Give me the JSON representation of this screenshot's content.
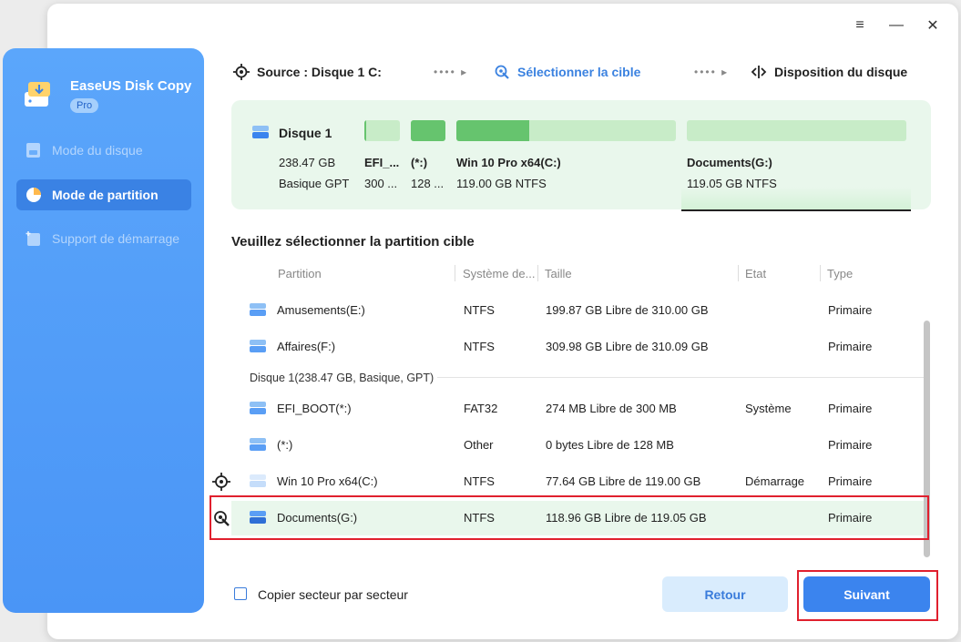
{
  "brand": {
    "name": "EaseUS Disk Copy",
    "badge": "Pro"
  },
  "nav": [
    {
      "label": "Mode du disque",
      "state": "disabled"
    },
    {
      "label": "Mode de partition",
      "state": "active"
    },
    {
      "label": "Support de démarrage",
      "state": "disabled"
    }
  ],
  "window_controls": {
    "menu": "≡",
    "minimize": "—",
    "close": "✕"
  },
  "steps": {
    "source": "Source : Disque 1 C:",
    "target": "Sélectionner la cible",
    "layout": "Disposition du disque",
    "separator": "•••• ▸"
  },
  "disk": {
    "title": "Disque 1",
    "size": "238.47 GB",
    "type": "Basique GPT",
    "partitions": [
      {
        "name": "EFI_...",
        "size": "300 ...",
        "fill": 0.05
      },
      {
        "name": "(*:)",
        "size": "128 ...",
        "fill": 1.0
      },
      {
        "name": "Win 10 Pro x64(C:)",
        "size": "119.00 GB NTFS",
        "fill": 0.33
      },
      {
        "name": "Documents(G:)",
        "size": "119.05 GB NTFS",
        "fill": 0.0
      }
    ]
  },
  "section_title": "Veuillez sélectionner la partition cible",
  "table": {
    "headers": [
      "Partition",
      "Système de...",
      "Taille",
      "Etat",
      "Type"
    ],
    "rows_top": [
      {
        "name": "Amusements(E:)",
        "fs": "NTFS",
        "size": "199.87 GB Libre de 310.00 GB",
        "state": "",
        "type": "Primaire"
      },
      {
        "name": "Affaires(F:)",
        "fs": "NTFS",
        "size": "309.98 GB Libre de 310.09 GB",
        "state": "",
        "type": "Primaire"
      }
    ],
    "group_label": "Disque 1(238.47 GB, Basique, GPT)",
    "rows_disk": [
      {
        "name": "EFI_BOOT(*:)",
        "fs": "FAT32",
        "size": "274 MB Libre de 300 MB",
        "state": "Système",
        "type": "Primaire"
      },
      {
        "name": "(*:)",
        "fs": "Other",
        "size": "0 bytes Libre de 128 MB",
        "state": "",
        "type": "Primaire"
      },
      {
        "name": "Win 10 Pro x64(C:)",
        "fs": "NTFS",
        "size": "77.64 GB Libre de 119.00 GB",
        "state": "Démarrage",
        "type": "Primaire"
      },
      {
        "name": "Documents(G:)",
        "fs": "NTFS",
        "size": "118.96 GB Libre de 119.05 GB",
        "state": "",
        "type": "Primaire"
      }
    ]
  },
  "footer": {
    "checkbox_label": "Copier secteur par secteur",
    "back": "Retour",
    "next": "Suivant"
  },
  "colors": {
    "accent": "#3b84ee",
    "sidebar": "#5ba6fb",
    "partition_green": "#66c46e",
    "highlight": "#e0202e"
  }
}
